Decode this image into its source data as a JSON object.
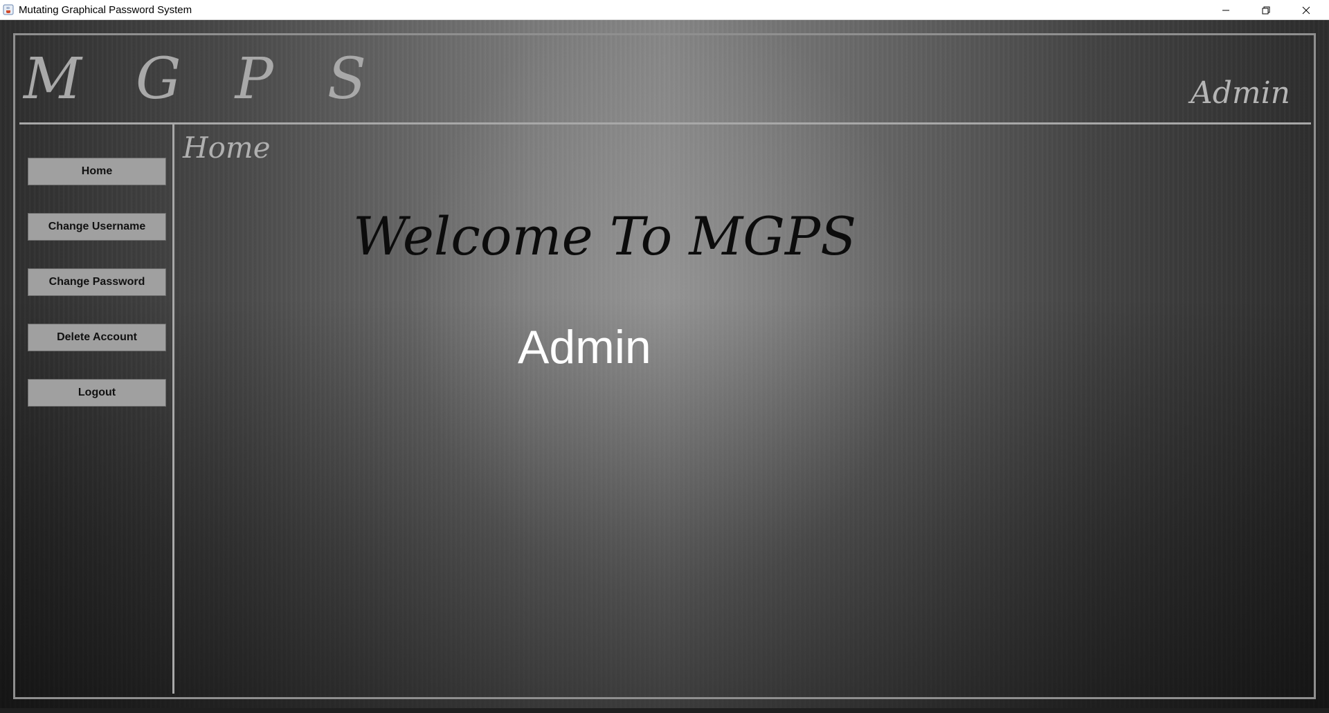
{
  "window": {
    "title": "Mutating Graphical Password System",
    "app_icon": "java-cup-icon",
    "controls": {
      "minimize_icon": "minimize-icon",
      "maximize_icon": "restore-icon",
      "close_icon": "close-icon"
    }
  },
  "header": {
    "logo": "M G P S",
    "username": "Admin"
  },
  "sidebar": {
    "items": [
      {
        "label": "Home"
      },
      {
        "label": "Change Username"
      },
      {
        "label": "Change Password"
      },
      {
        "label": "Delete Account"
      },
      {
        "label": "Logout"
      }
    ]
  },
  "main": {
    "section_title": "Home",
    "welcome_text": "Welcome To MGPS",
    "welcome_user": "Admin"
  },
  "colors": {
    "background_dark": "#2d2d2d",
    "background_light": "#858585",
    "button_bg": "#a0a0a0",
    "border": "#a8a8a8",
    "welcome_text": "#0c0c0c",
    "welcome_user": "#ffffff"
  }
}
